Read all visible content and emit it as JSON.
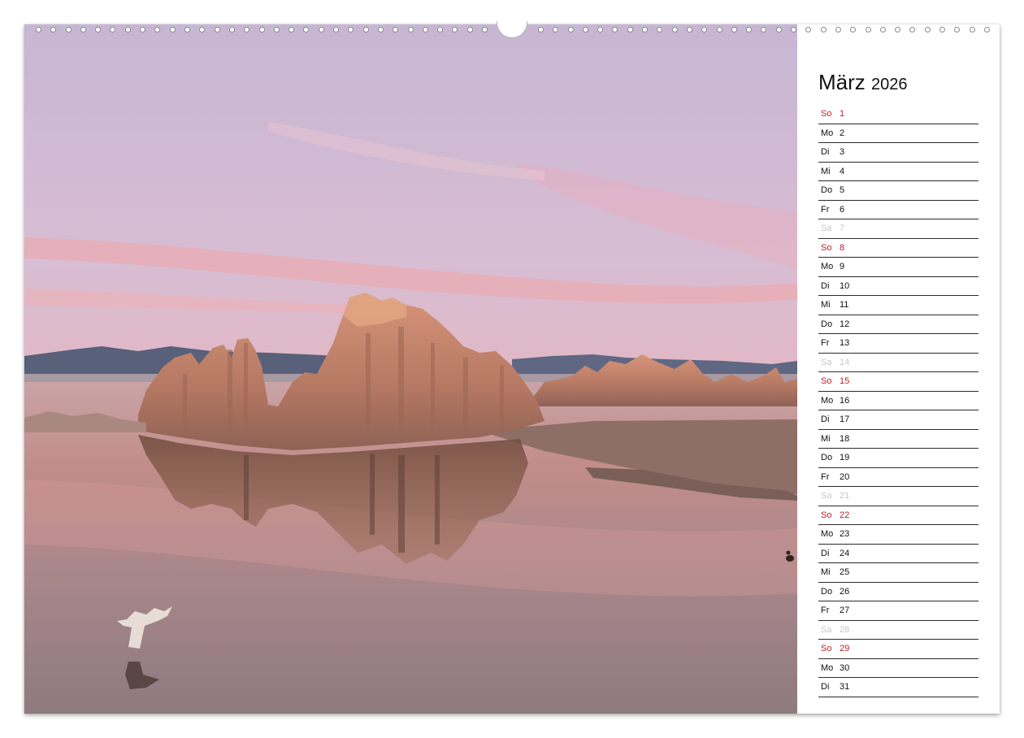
{
  "calendar": {
    "month": "März",
    "year": "2026",
    "days": [
      {
        "wd": "So",
        "d": "1",
        "type": "sun"
      },
      {
        "wd": "Mo",
        "d": "2",
        "type": "day"
      },
      {
        "wd": "Di",
        "d": "3",
        "type": "day"
      },
      {
        "wd": "Mi",
        "d": "4",
        "type": "day"
      },
      {
        "wd": "Do",
        "d": "5",
        "type": "day"
      },
      {
        "wd": "Fr",
        "d": "6",
        "type": "day"
      },
      {
        "wd": "Sa",
        "d": "7",
        "type": "sat"
      },
      {
        "wd": "So",
        "d": "8",
        "type": "sun"
      },
      {
        "wd": "Mo",
        "d": "9",
        "type": "day"
      },
      {
        "wd": "Di",
        "d": "10",
        "type": "day"
      },
      {
        "wd": "Mi",
        "d": "11",
        "type": "day"
      },
      {
        "wd": "Do",
        "d": "12",
        "type": "day"
      },
      {
        "wd": "Fr",
        "d": "13",
        "type": "day"
      },
      {
        "wd": "Sa",
        "d": "14",
        "type": "sat"
      },
      {
        "wd": "So",
        "d": "15",
        "type": "sun"
      },
      {
        "wd": "Mo",
        "d": "16",
        "type": "day"
      },
      {
        "wd": "Di",
        "d": "17",
        "type": "day"
      },
      {
        "wd": "Mi",
        "d": "18",
        "type": "day"
      },
      {
        "wd": "Do",
        "d": "19",
        "type": "day"
      },
      {
        "wd": "Fr",
        "d": "20",
        "type": "day"
      },
      {
        "wd": "Sa",
        "d": "21",
        "type": "sat"
      },
      {
        "wd": "So",
        "d": "22",
        "type": "sun"
      },
      {
        "wd": "Mo",
        "d": "23",
        "type": "day"
      },
      {
        "wd": "Di",
        "d": "24",
        "type": "day"
      },
      {
        "wd": "Mi",
        "d": "25",
        "type": "day"
      },
      {
        "wd": "Do",
        "d": "26",
        "type": "day"
      },
      {
        "wd": "Fr",
        "d": "27",
        "type": "day"
      },
      {
        "wd": "Sa",
        "d": "28",
        "type": "sat"
      },
      {
        "wd": "So",
        "d": "29",
        "type": "sun"
      },
      {
        "wd": "Mo",
        "d": "30",
        "type": "day"
      },
      {
        "wd": "Di",
        "d": "31",
        "type": "day"
      }
    ]
  },
  "colors": {
    "sunday": "#c0202a",
    "saturday": "#c8c8c8",
    "weekday": "#111111",
    "rule": "#2a2a2a"
  },
  "photo": {
    "subject": "tufa-towers-lake-sunset"
  }
}
